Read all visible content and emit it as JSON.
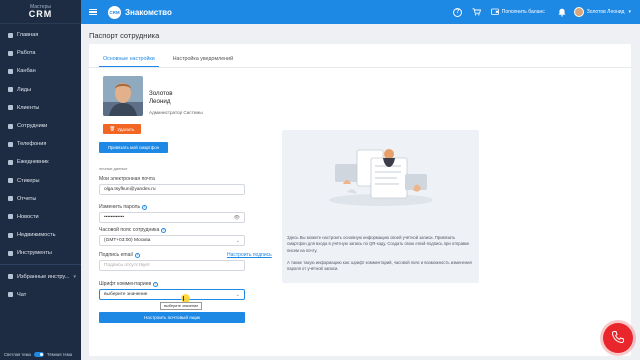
{
  "sidebar": {
    "logo_top": "Мастеры",
    "logo_main": "CRM",
    "items": [
      {
        "label": "Главная",
        "icon": "home-icon"
      },
      {
        "label": "Работа",
        "icon": "briefcase-icon"
      },
      {
        "label": "Канбан",
        "icon": "kanban-icon"
      },
      {
        "label": "Лиды",
        "icon": "filter-icon"
      },
      {
        "label": "Клиенты",
        "icon": "chat-icon"
      },
      {
        "label": "Сотрудники",
        "icon": "users-icon"
      },
      {
        "label": "Телефония",
        "icon": "phone-icon"
      },
      {
        "label": "Ежедневник",
        "icon": "calendar-icon"
      },
      {
        "label": "Стикеры",
        "icon": "sticker-icon"
      },
      {
        "label": "Отчеты",
        "icon": "report-icon"
      },
      {
        "label": "Новости",
        "icon": "news-icon"
      },
      {
        "label": "Недвижимость",
        "icon": "building-icon"
      },
      {
        "label": "Инструменты",
        "icon": "tools-icon"
      }
    ],
    "favorites_label": "Избранные инстру...",
    "chat_label": "Чат",
    "footer": {
      "light_label": "Светлая тема",
      "dark_label": "Тёмная тема"
    }
  },
  "header": {
    "brand": "CRM",
    "title": "Знакомство",
    "balance_label": "Пополнить баланс",
    "user_name": "Золотов Леонид"
  },
  "page": {
    "title": "Паспорт сотрудника",
    "tabs": [
      "Основные настройки",
      "Настройка уведомлений"
    ]
  },
  "profile": {
    "first_line": "Золотов",
    "second_line": "Леонид",
    "role": "Администратор Системы",
    "delete_label": "Удалить",
    "bind_smartphone_label": "Привязать мой смартфон"
  },
  "form": {
    "section_label": "личные данные",
    "email_label": "Мои электронная почта",
    "email_value": "olga.tsyfkun@yandex.ru",
    "password_label": "Изменить пароль",
    "password_value": "••••••••••••",
    "timezone_label": "Часовой пояс сотрудника",
    "timezone_value": "(GMT+03:00) Москва",
    "signature_label": "Подпись email",
    "signature_link": "Настроить подпись",
    "signature_placeholder": "Подпись отсутствует",
    "font_label": "Шрифт комментариев",
    "font_value": "выберите значение",
    "tooltip": "выберите значение",
    "mail_button": "Настроить почтовый ящик"
  },
  "info_panel": {
    "text1": "Здесь Вы можете настроить основную информацию своей учётной записи. Привязать смартфон для входа в учётную запись по QR-коду. Создать свою email-подпись при отправке писем на почту.",
    "text2": "А также такую информацию как: шрифт комментарий, часовой пояс и возможность изменения пароля от учётной записи."
  },
  "colors": {
    "accent": "#1e88e5",
    "sidebar": "#1d2c42",
    "danger": "#f26522",
    "call": "#e8262c"
  }
}
